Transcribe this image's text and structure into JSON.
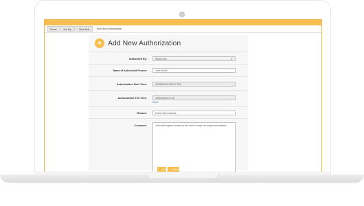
{
  "breadcrumb": [
    "Home",
    "Jon Fry",
    "View Unit",
    "Add New Authorization"
  ],
  "page": {
    "title": "Add New Authorization",
    "icon": "key-icon"
  },
  "form": {
    "authorized_by": {
      "label": "Authorized By:",
      "value": "Mary Gina"
    },
    "name": {
      "label": "Name of Authorized Person:",
      "value": "John Smith"
    },
    "start_time": {
      "label": "Authorization Start Time:",
      "value": "10/28/2018 4:05:27 PM"
    },
    "end_time": {
      "label": "Authorization End Time:",
      "value": "10/31/2018 17:00",
      "clear_link": "Clear"
    },
    "reason": {
      "label": "Reason:",
      "value": "Home Renovations"
    },
    "comment": {
      "label": "Comment:",
      "value": "John will require access to the unit to carry out major renovations"
    }
  },
  "buttons": {
    "save": "Save",
    "cancel": "Cancel"
  },
  "colors": {
    "accent": "#f5be4f",
    "link": "#3a7fc4",
    "comment_icon": "#3fa35b"
  }
}
